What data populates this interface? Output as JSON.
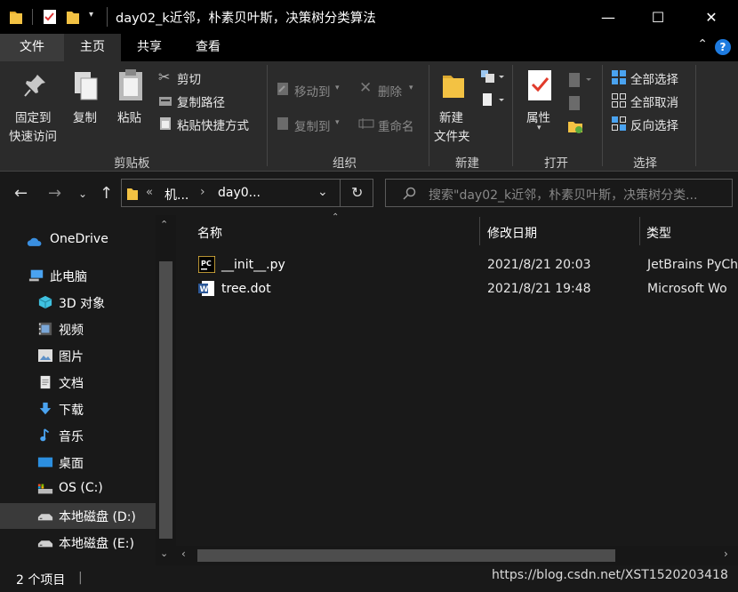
{
  "window": {
    "title": "day02_k近邻，朴素贝叶斯，决策树分类算法",
    "minimize": "—",
    "maximize": "☐",
    "close": "✕"
  },
  "ribbon_tabs": {
    "file": "文件",
    "home": "主页",
    "share": "共享",
    "view": "查看"
  },
  "clipboard": {
    "pin_line1": "固定到",
    "pin_line2": "快速访问",
    "copy": "复制",
    "paste": "粘贴",
    "cut": "剪切",
    "copy_path": "复制路径",
    "paste_shortcut": "粘贴快捷方式",
    "group": "剪贴板"
  },
  "organize": {
    "move_to": "移动到",
    "copy_to": "复制到",
    "delete": "删除",
    "rename": "重命名",
    "group": "组织"
  },
  "new_group": {
    "new_folder_line1": "新建",
    "new_folder_line2": "文件夹",
    "group": "新建"
  },
  "open_group": {
    "properties": "属性",
    "group": "打开"
  },
  "select_group": {
    "select_all": "全部选择",
    "select_none": "全部取消",
    "invert": "反向选择",
    "group": "选择"
  },
  "address": {
    "crumb_1": "机...",
    "crumb_2": "day0...",
    "search_placeholder": "搜索\"day02_k近邻，朴素贝叶斯，决策树分类..."
  },
  "nav_pane": {
    "items": [
      {
        "label": "OneDrive",
        "icon": "onedrive-icon"
      },
      {
        "label": "此电脑",
        "icon": "pc-icon"
      },
      {
        "label": "3D 对象",
        "icon": "3d-objects-icon"
      },
      {
        "label": "视频",
        "icon": "video-icon"
      },
      {
        "label": "图片",
        "icon": "pictures-icon"
      },
      {
        "label": "文档",
        "icon": "documents-icon"
      },
      {
        "label": "下载",
        "icon": "downloads-icon"
      },
      {
        "label": "音乐",
        "icon": "music-icon"
      },
      {
        "label": "桌面",
        "icon": "desktop-icon"
      },
      {
        "label": "OS (C:)",
        "icon": "drive-c-icon"
      },
      {
        "label": "本地磁盘 (D:)",
        "icon": "drive-icon"
      },
      {
        "label": "本地磁盘 (E:)",
        "icon": "drive-icon"
      }
    ]
  },
  "file_list": {
    "columns": {
      "name": "名称",
      "modified": "修改日期",
      "type": "类型"
    },
    "rows": [
      {
        "name": "__init__.py",
        "modified": "2021/8/21 20:03",
        "type": "JetBrains PyCh",
        "icon": "pycharm-file-icon"
      },
      {
        "name": "tree.dot",
        "modified": "2021/8/21 19:48",
        "type": "Microsoft Wo",
        "icon": "word-file-icon"
      }
    ]
  },
  "status": {
    "count": "2 个项目",
    "watermark": "https://blog.csdn.net/XST1520203418"
  },
  "colors": {
    "background": "#191919",
    "ribbon": "#2b2b2b",
    "folder": "#f3c243",
    "accent_blue": "#1e7be0"
  }
}
